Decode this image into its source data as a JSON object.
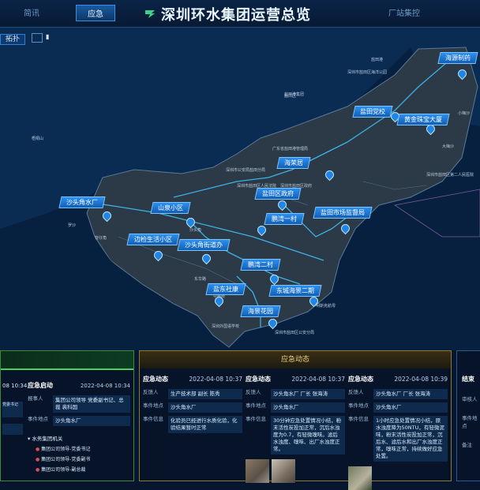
{
  "header": {
    "tabs": [
      {
        "label": "简讯"
      },
      {
        "label": "应急"
      },
      {
        "label": "厂站集控"
      }
    ],
    "title": "深圳环水集团运营总览"
  },
  "toolbar": {
    "expand_label": "拓扑"
  },
  "map": {
    "stations": [
      {
        "label": "海源制药"
      },
      {
        "label": "盐田党校"
      },
      {
        "label": "黄金珠宝大厦"
      },
      {
        "label": "海荣居"
      },
      {
        "label": "盐田区政府"
      },
      {
        "label": "沙头角水厂"
      },
      {
        "label": "山泉小区"
      },
      {
        "label": "鹏湾一村"
      },
      {
        "label": "盐田市场监督局"
      },
      {
        "label": "边检生活小区"
      },
      {
        "label": "沙头角街道办"
      },
      {
        "label": "鹏湾二村"
      },
      {
        "label": "盐东社康"
      },
      {
        "label": "东城海景二期"
      },
      {
        "label": "海景花园"
      }
    ],
    "place_names": [
      "盐田港",
      "背仔角",
      "罗沙",
      "深圳市公安局盐田分局",
      "深圳市盐田区海洋公园",
      "盐田港集团",
      "广东省盐田港管理局",
      "深圳市盐田区政府",
      "深圳市盐田区人民法院",
      "东华路",
      "盐田区",
      "中英街",
      "沙头角",
      "明斯克航母",
      "深圳市盐田区第二人民医院",
      "大梅沙",
      "小梅沙",
      "梧桐山",
      "深圳外国语学校",
      "深圳市盐田区公安分局"
    ]
  },
  "panels": {
    "left": {
      "date_partial": "08 10:34",
      "card": {
        "title": "应急启动",
        "date": "2022-04-08 10:34",
        "reporter_label": "报事人",
        "reporter": "集团公司领导 党委副书记、总裁 裴科国",
        "location_label": "事件地点",
        "location": "沙头角水厂"
      },
      "tree": {
        "root": "水务集团机关",
        "items": [
          "集团公司领导-党委书记",
          "集团公司领导-党委副书",
          "集团公司领导-副总裁"
        ]
      },
      "left_partial": [
        "党委书记",
        "",
        "",
        ""
      ]
    },
    "center": {
      "header": "应急动态",
      "cards": [
        {
          "title": "应急动态",
          "date": "2022-04-08 10:37",
          "reporter_label": "反馈人",
          "reporter": "生产技术部 副长 陈秀",
          "location_label": "事件地点",
          "location": "沙头角水厂",
          "info_label": "事件信息",
          "info": "化验员已经进行水质化验，化验结果暂时正常",
          "has_photos": false
        },
        {
          "title": "应急动态",
          "date": "2022-04-08 10:37",
          "reporter_label": "反馈人",
          "reporter": "沙头角水厂 厂长 张海涛",
          "location_label": "事件地点",
          "location": "沙头角水厂",
          "info_label": "事件信息",
          "info": "30分钟应急处置情况小结，粉末活性炭投加正常，沉后水浊度为0.7，有轻微嗅味。滤后水浊度、嗅味、出厂水浊度正常。",
          "has_photos": true
        },
        {
          "title": "应急动态",
          "date": "2022-04-08 10:39",
          "reporter_label": "反馈人",
          "reporter": "沙头角水厂 厂长 张海涛",
          "location_label": "事件地点",
          "location": "沙头角水厂",
          "info_label": "事件信息",
          "info": "1小时应急处置情况小结，原水浊度降为50NTU，有轻微泥味，粉末活性炭投加正常，沉后水、滤后水和出厂水浊度正常，嗅味正常，持续做好应急处置。",
          "has_photos": true
        }
      ]
    },
    "right": {
      "title": "结束",
      "labels": [
        "审核人",
        "事件地点",
        "备注"
      ]
    }
  }
}
